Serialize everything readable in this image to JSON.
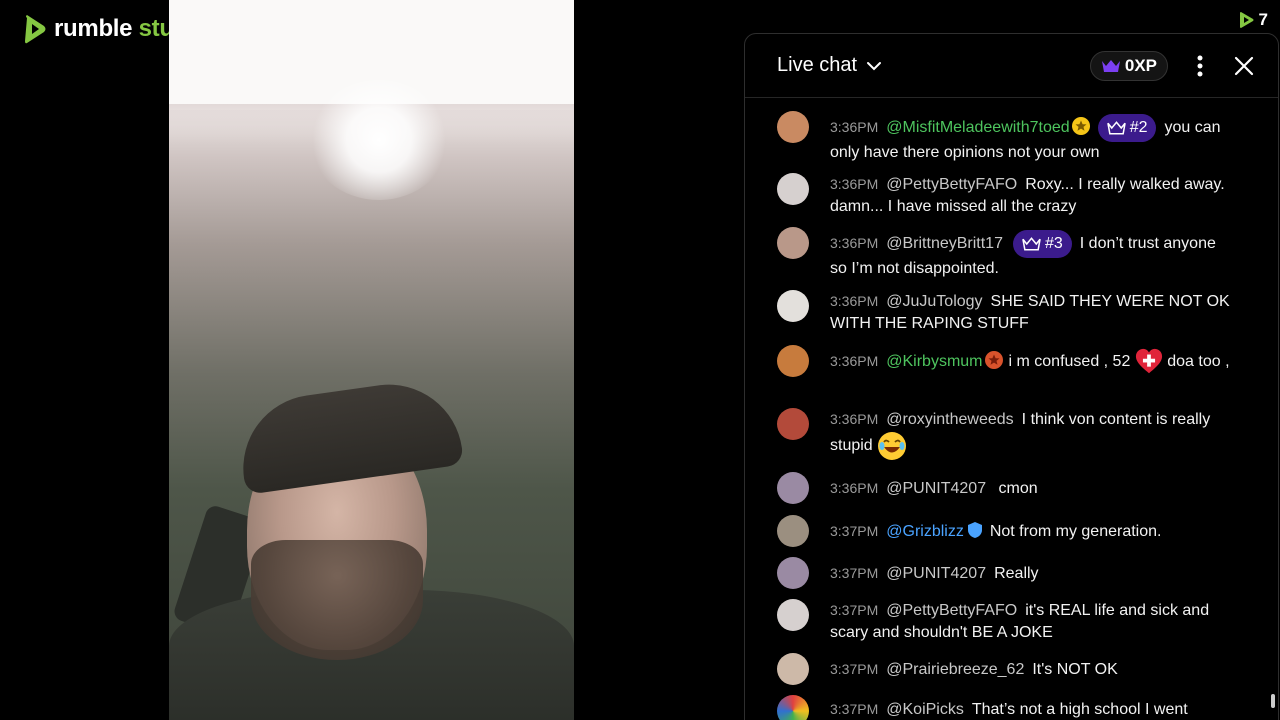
{
  "brand": {
    "name_part1": "rumble",
    "name_part2": " studio"
  },
  "viewer_count": "7",
  "chat": {
    "title": "Live chat",
    "xp": "0XP",
    "messages": [
      {
        "time": "3:36PM",
        "user": "@MisfitMeladeewith7toed",
        "user_color": "#4ec45e",
        "badge": "star",
        "rank": "#2",
        "text": "you can only have there opinions not your own",
        "avatar_color": "#c98a62"
      },
      {
        "time": "3:36PM",
        "user": "@PettyBettyFAFO",
        "user_color": "#c8c8c8",
        "text": "Roxy... I really walked away. damn... I have missed all the crazy",
        "avatar_color": "#d6d0cf"
      },
      {
        "time": "3:36PM",
        "user": "@BrittneyBritt17",
        "user_color": "#c8c8c8",
        "rank": "#3",
        "text": "I don’t trust anyone so I’m not disappointed.",
        "avatar_color": "#b99889"
      },
      {
        "time": "3:36PM",
        "user": "@JuJuTology",
        "user_color": "#c8c8c8",
        "text": "SHE SAID THEY WERE NOT OK WITH THE RAPING STUFF",
        "avatar_color": "#e3e0dc"
      },
      {
        "time": "3:36PM",
        "user": "@Kirbysmum",
        "user_color": "#4ec45e",
        "badge": "star-red",
        "text_before": "i m confused , 52",
        "emoji": "heart-plus",
        "text": "doa too ,",
        "avatar_color": "#c77b3d"
      },
      {
        "time": "3:36PM",
        "user": "@roxyintheweeds",
        "user_color": "#c8c8c8",
        "text": "I think von content is really stupid",
        "emoji": "laughing",
        "avatar_color": "#b34a3a"
      },
      {
        "time": "3:36PM",
        "user": "@PUNIT4207",
        "user_color": "#c8c8c8",
        "text": "cmon",
        "avatar_color": "#9a8aa3"
      },
      {
        "time": "3:37PM",
        "user": "@Grizblizz",
        "user_color": "#4aa3ff",
        "badge": "shield",
        "text": "Not from my generation.",
        "avatar_color": "#9b8f80"
      },
      {
        "time": "3:37PM",
        "user": "@PUNIT4207",
        "user_color": "#c8c8c8",
        "text": "Really",
        "avatar_color": "#9a8aa3"
      },
      {
        "time": "3:37PM",
        "user": "@PettyBettyFAFO",
        "user_color": "#c8c8c8",
        "text": "it's REAL life and sick and scary and shouldn't BE A JOKE",
        "avatar_color": "#d6d0cf"
      },
      {
        "time": "3:37PM",
        "user": "@Prairiebreeze_62",
        "user_color": "#c8c8c8",
        "text": "It's NOT OK",
        "avatar_color": "#cdb9a8"
      },
      {
        "time": "3:37PM",
        "user": "@KoiPicks",
        "user_color": "#c8c8c8",
        "text": "That’s not a high school I went",
        "avatar_color": "#3f8f4a"
      }
    ]
  }
}
